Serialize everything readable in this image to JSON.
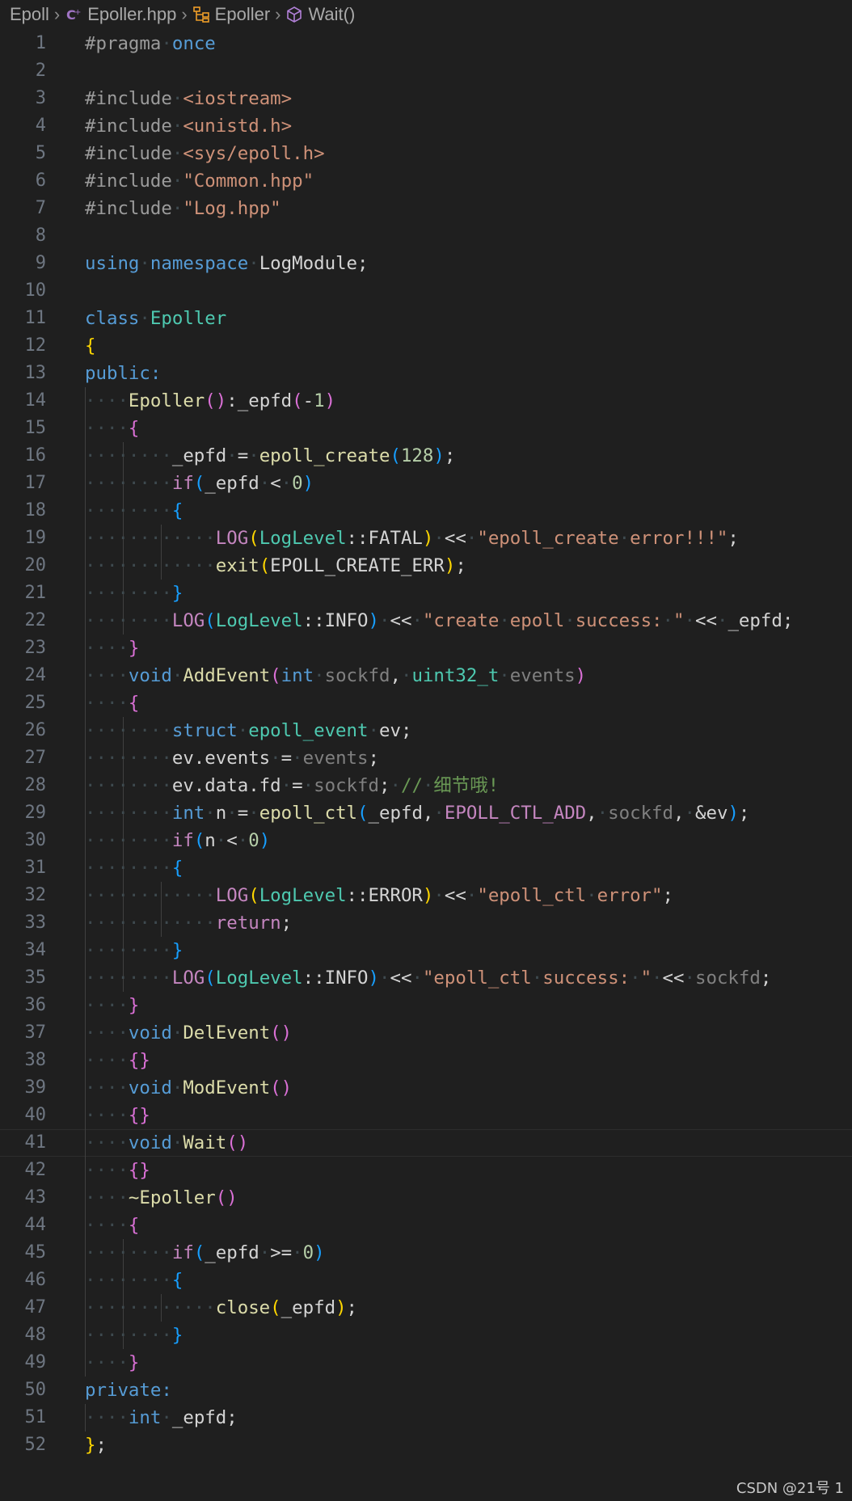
{
  "breadcrumb": {
    "items": [
      {
        "label": "Epoll",
        "icon": ""
      },
      {
        "label": "Epoller.hpp",
        "icon": "cpp-file-icon"
      },
      {
        "label": "Epoller",
        "icon": "class-icon"
      },
      {
        "label": "Wait()",
        "icon": "method-cube-icon"
      }
    ],
    "separator": ">"
  },
  "watermark": "CSDN @21号 1",
  "editor": {
    "current_line": 41,
    "lines": [
      {
        "n": "1",
        "indent": 0,
        "t": [
          [
            "pre",
            "#pragma"
          ],
          [
            "ws",
            "·"
          ],
          [
            "kw",
            "once"
          ]
        ]
      },
      {
        "n": "2",
        "indent": 0,
        "t": []
      },
      {
        "n": "3",
        "indent": 0,
        "t": [
          [
            "pre",
            "#include"
          ],
          [
            "ws",
            "·"
          ],
          [
            "inc",
            "<iostream>"
          ]
        ]
      },
      {
        "n": "4",
        "indent": 0,
        "t": [
          [
            "pre",
            "#include"
          ],
          [
            "ws",
            "·"
          ],
          [
            "inc",
            "<unistd.h>"
          ]
        ]
      },
      {
        "n": "5",
        "indent": 0,
        "t": [
          [
            "pre",
            "#include"
          ],
          [
            "ws",
            "·"
          ],
          [
            "inc",
            "<sys/epoll.h>"
          ]
        ]
      },
      {
        "n": "6",
        "indent": 0,
        "t": [
          [
            "pre",
            "#include"
          ],
          [
            "ws",
            "·"
          ],
          [
            "inc",
            "\"Common.hpp\""
          ]
        ]
      },
      {
        "n": "7",
        "indent": 0,
        "t": [
          [
            "pre",
            "#include"
          ],
          [
            "ws",
            "·"
          ],
          [
            "inc",
            "\"Log.hpp\""
          ]
        ]
      },
      {
        "n": "8",
        "indent": 0,
        "t": []
      },
      {
        "n": "9",
        "indent": 0,
        "t": [
          [
            "kw",
            "using"
          ],
          [
            "ws",
            "·"
          ],
          [
            "kw",
            "namespace"
          ],
          [
            "ws",
            "·"
          ],
          [
            "plain",
            "LogModule;"
          ]
        ]
      },
      {
        "n": "10",
        "indent": 0,
        "t": []
      },
      {
        "n": "11",
        "indent": 0,
        "t": [
          [
            "kw",
            "class"
          ],
          [
            "ws",
            "·"
          ],
          [
            "type",
            "Epoller"
          ]
        ]
      },
      {
        "n": "12",
        "indent": 0,
        "t": [
          [
            "b1",
            "{"
          ]
        ]
      },
      {
        "n": "13",
        "indent": 0,
        "t": [
          [
            "kw",
            "public:"
          ]
        ]
      },
      {
        "n": "14",
        "indent": 1,
        "t": [
          [
            "fn",
            "Epoller"
          ],
          [
            "b2",
            "()"
          ],
          [
            "op",
            ":"
          ],
          [
            "plain",
            "_epfd"
          ],
          [
            "b2",
            "("
          ],
          [
            "op",
            "-"
          ],
          [
            "num",
            "1"
          ],
          [
            "b2",
            ")"
          ]
        ]
      },
      {
        "n": "15",
        "indent": 1,
        "t": [
          [
            "b2",
            "{"
          ]
        ]
      },
      {
        "n": "16",
        "indent": 2,
        "t": [
          [
            "plain",
            "_epfd"
          ],
          [
            "ws",
            "·"
          ],
          [
            "op",
            "="
          ],
          [
            "ws",
            "·"
          ],
          [
            "fn",
            "epoll_create"
          ],
          [
            "b3",
            "("
          ],
          [
            "num",
            "128"
          ],
          [
            "b3",
            ")"
          ],
          [
            "plain",
            ";"
          ]
        ]
      },
      {
        "n": "17",
        "indent": 2,
        "t": [
          [
            "ctl",
            "if"
          ],
          [
            "b3",
            "("
          ],
          [
            "plain",
            "_epfd"
          ],
          [
            "ws",
            "·"
          ],
          [
            "op",
            "<"
          ],
          [
            "ws",
            "·"
          ],
          [
            "num",
            "0"
          ],
          [
            "b3",
            ")"
          ]
        ]
      },
      {
        "n": "18",
        "indent": 2,
        "t": [
          [
            "b3",
            "{"
          ]
        ]
      },
      {
        "n": "19",
        "indent": 3,
        "t": [
          [
            "mac",
            "LOG"
          ],
          [
            "b1",
            "("
          ],
          [
            "type",
            "LogLevel"
          ],
          [
            "op",
            "::"
          ],
          [
            "plain",
            "FATAL"
          ],
          [
            "b1",
            ")"
          ],
          [
            "ws",
            "·"
          ],
          [
            "op",
            "<<"
          ],
          [
            "ws",
            "·"
          ],
          [
            "str",
            "\"epoll_create"
          ],
          [
            "ws",
            "·"
          ],
          [
            "str",
            "error!!!\""
          ],
          [
            "plain",
            ";"
          ]
        ]
      },
      {
        "n": "20",
        "indent": 3,
        "t": [
          [
            "fn",
            "exit"
          ],
          [
            "b1",
            "("
          ],
          [
            "plain",
            "EPOLL_CREATE_ERR"
          ],
          [
            "b1",
            ")"
          ],
          [
            "plain",
            ";"
          ]
        ]
      },
      {
        "n": "21",
        "indent": 2,
        "t": [
          [
            "b3",
            "}"
          ]
        ]
      },
      {
        "n": "22",
        "indent": 2,
        "t": [
          [
            "mac",
            "LOG"
          ],
          [
            "b3",
            "("
          ],
          [
            "type",
            "LogLevel"
          ],
          [
            "op",
            "::"
          ],
          [
            "plain",
            "INFO"
          ],
          [
            "b3",
            ")"
          ],
          [
            "ws",
            "·"
          ],
          [
            "op",
            "<<"
          ],
          [
            "ws",
            "·"
          ],
          [
            "str",
            "\"create"
          ],
          [
            "ws",
            "·"
          ],
          [
            "str",
            "epoll"
          ],
          [
            "ws",
            "·"
          ],
          [
            "str",
            "success:"
          ],
          [
            "ws",
            "·"
          ],
          [
            "str",
            "\""
          ],
          [
            "ws",
            "·"
          ],
          [
            "op",
            "<<"
          ],
          [
            "ws",
            "·"
          ],
          [
            "plain",
            "_epfd;"
          ]
        ]
      },
      {
        "n": "23",
        "indent": 1,
        "t": [
          [
            "b2",
            "}"
          ]
        ]
      },
      {
        "n": "24",
        "indent": 1,
        "t": [
          [
            "kw",
            "void"
          ],
          [
            "ws",
            "·"
          ],
          [
            "fn",
            "AddEvent"
          ],
          [
            "b2",
            "("
          ],
          [
            "kw",
            "int"
          ],
          [
            "ws",
            "·"
          ],
          [
            "par",
            "sockfd"
          ],
          [
            "plain",
            ","
          ],
          [
            "ws",
            "·"
          ],
          [
            "type",
            "uint32_t"
          ],
          [
            "ws",
            "·"
          ],
          [
            "par",
            "events"
          ],
          [
            "b2",
            ")"
          ]
        ]
      },
      {
        "n": "25",
        "indent": 1,
        "t": [
          [
            "b2",
            "{"
          ]
        ]
      },
      {
        "n": "26",
        "indent": 2,
        "t": [
          [
            "kw",
            "struct"
          ],
          [
            "ws",
            "·"
          ],
          [
            "type",
            "epoll_event"
          ],
          [
            "ws",
            "·"
          ],
          [
            "plain",
            "ev;"
          ]
        ]
      },
      {
        "n": "27",
        "indent": 2,
        "t": [
          [
            "plain",
            "ev.events"
          ],
          [
            "ws",
            "·"
          ],
          [
            "op",
            "="
          ],
          [
            "ws",
            "·"
          ],
          [
            "par",
            "events"
          ],
          [
            "plain",
            ";"
          ]
        ]
      },
      {
        "n": "28",
        "indent": 2,
        "t": [
          [
            "plain",
            "ev.data.fd"
          ],
          [
            "ws",
            "·"
          ],
          [
            "op",
            "="
          ],
          [
            "ws",
            "·"
          ],
          [
            "par",
            "sockfd"
          ],
          [
            "plain",
            ";"
          ],
          [
            "ws",
            "·"
          ],
          [
            "cmt",
            "//"
          ],
          [
            "ws",
            "·"
          ],
          [
            "cmt",
            "细节哦!"
          ]
        ]
      },
      {
        "n": "29",
        "indent": 2,
        "t": [
          [
            "kw",
            "int"
          ],
          [
            "ws",
            "·"
          ],
          [
            "plain",
            "n"
          ],
          [
            "ws",
            "·"
          ],
          [
            "op",
            "="
          ],
          [
            "ws",
            "·"
          ],
          [
            "fn",
            "epoll_ctl"
          ],
          [
            "b3",
            "("
          ],
          [
            "plain",
            "_epfd,"
          ],
          [
            "ws",
            "·"
          ],
          [
            "mac",
            "EPOLL_CTL_ADD"
          ],
          [
            "plain",
            ","
          ],
          [
            "ws",
            "·"
          ],
          [
            "par",
            "sockfd"
          ],
          [
            "plain",
            ","
          ],
          [
            "ws",
            "·"
          ],
          [
            "plain",
            "&ev"
          ],
          [
            "b3",
            ")"
          ],
          [
            "plain",
            ";"
          ]
        ]
      },
      {
        "n": "30",
        "indent": 2,
        "t": [
          [
            "ctl",
            "if"
          ],
          [
            "b3",
            "("
          ],
          [
            "plain",
            "n"
          ],
          [
            "ws",
            "·"
          ],
          [
            "op",
            "<"
          ],
          [
            "ws",
            "·"
          ],
          [
            "num",
            "0"
          ],
          [
            "b3",
            ")"
          ]
        ]
      },
      {
        "n": "31",
        "indent": 2,
        "t": [
          [
            "b3",
            "{"
          ]
        ]
      },
      {
        "n": "32",
        "indent": 3,
        "t": [
          [
            "mac",
            "LOG"
          ],
          [
            "b1",
            "("
          ],
          [
            "type",
            "LogLevel"
          ],
          [
            "op",
            "::"
          ],
          [
            "plain",
            "ERROR"
          ],
          [
            "b1",
            ")"
          ],
          [
            "ws",
            "·"
          ],
          [
            "op",
            "<<"
          ],
          [
            "ws",
            "·"
          ],
          [
            "str",
            "\"epoll_ctl"
          ],
          [
            "ws",
            "·"
          ],
          [
            "str",
            "error\""
          ],
          [
            "plain",
            ";"
          ]
        ]
      },
      {
        "n": "33",
        "indent": 3,
        "t": [
          [
            "ctl",
            "return"
          ],
          [
            "plain",
            ";"
          ]
        ]
      },
      {
        "n": "34",
        "indent": 2,
        "t": [
          [
            "b3",
            "}"
          ]
        ]
      },
      {
        "n": "35",
        "indent": 2,
        "t": [
          [
            "mac",
            "LOG"
          ],
          [
            "b3",
            "("
          ],
          [
            "type",
            "LogLevel"
          ],
          [
            "op",
            "::"
          ],
          [
            "plain",
            "INFO"
          ],
          [
            "b3",
            ")"
          ],
          [
            "ws",
            "·"
          ],
          [
            "op",
            "<<"
          ],
          [
            "ws",
            "·"
          ],
          [
            "str",
            "\"epoll_ctl"
          ],
          [
            "ws",
            "·"
          ],
          [
            "str",
            "success:"
          ],
          [
            "ws",
            "·"
          ],
          [
            "str",
            "\""
          ],
          [
            "ws",
            "·"
          ],
          [
            "op",
            "<<"
          ],
          [
            "ws",
            "·"
          ],
          [
            "par",
            "sockfd"
          ],
          [
            "plain",
            ";"
          ]
        ]
      },
      {
        "n": "36",
        "indent": 1,
        "t": [
          [
            "b2",
            "}"
          ]
        ]
      },
      {
        "n": "37",
        "indent": 1,
        "t": [
          [
            "kw",
            "void"
          ],
          [
            "ws",
            "·"
          ],
          [
            "fn",
            "DelEvent"
          ],
          [
            "b2",
            "()"
          ]
        ]
      },
      {
        "n": "38",
        "indent": 1,
        "t": [
          [
            "b2",
            "{}"
          ]
        ]
      },
      {
        "n": "39",
        "indent": 1,
        "t": [
          [
            "kw",
            "void"
          ],
          [
            "ws",
            "·"
          ],
          [
            "fn",
            "ModEvent"
          ],
          [
            "b2",
            "()"
          ]
        ]
      },
      {
        "n": "40",
        "indent": 1,
        "t": [
          [
            "b2",
            "{}"
          ]
        ]
      },
      {
        "n": "41",
        "indent": 1,
        "t": [
          [
            "kw",
            "void"
          ],
          [
            "ws",
            "·"
          ],
          [
            "fn",
            "Wait"
          ],
          [
            "b2",
            "()"
          ]
        ]
      },
      {
        "n": "42",
        "indent": 1,
        "t": [
          [
            "b2",
            "{}"
          ]
        ]
      },
      {
        "n": "43",
        "indent": 1,
        "t": [
          [
            "fn",
            "~Epoller"
          ],
          [
            "b2",
            "()"
          ]
        ]
      },
      {
        "n": "44",
        "indent": 1,
        "t": [
          [
            "b2",
            "{"
          ]
        ]
      },
      {
        "n": "45",
        "indent": 2,
        "t": [
          [
            "ctl",
            "if"
          ],
          [
            "b3",
            "("
          ],
          [
            "plain",
            "_epfd"
          ],
          [
            "ws",
            "·"
          ],
          [
            "op",
            ">="
          ],
          [
            "ws",
            "·"
          ],
          [
            "num",
            "0"
          ],
          [
            "b3",
            ")"
          ]
        ]
      },
      {
        "n": "46",
        "indent": 2,
        "t": [
          [
            "b3",
            "{"
          ]
        ]
      },
      {
        "n": "47",
        "indent": 3,
        "t": [
          [
            "fn",
            "close"
          ],
          [
            "b1",
            "("
          ],
          [
            "plain",
            "_epfd"
          ],
          [
            "b1",
            ")"
          ],
          [
            "plain",
            ";"
          ]
        ]
      },
      {
        "n": "48",
        "indent": 2,
        "t": [
          [
            "b3",
            "}"
          ]
        ]
      },
      {
        "n": "49",
        "indent": 1,
        "t": [
          [
            "b2",
            "}"
          ]
        ]
      },
      {
        "n": "50",
        "indent": 0,
        "t": [
          [
            "kw",
            "private:"
          ]
        ]
      },
      {
        "n": "51",
        "indent": 1,
        "t": [
          [
            "kw",
            "int"
          ],
          [
            "ws",
            "·"
          ],
          [
            "plain",
            "_epfd;"
          ]
        ]
      },
      {
        "n": "52",
        "indent": 0,
        "t": [
          [
            "b1",
            "}"
          ],
          [
            "plain",
            ";"
          ]
        ]
      }
    ]
  }
}
